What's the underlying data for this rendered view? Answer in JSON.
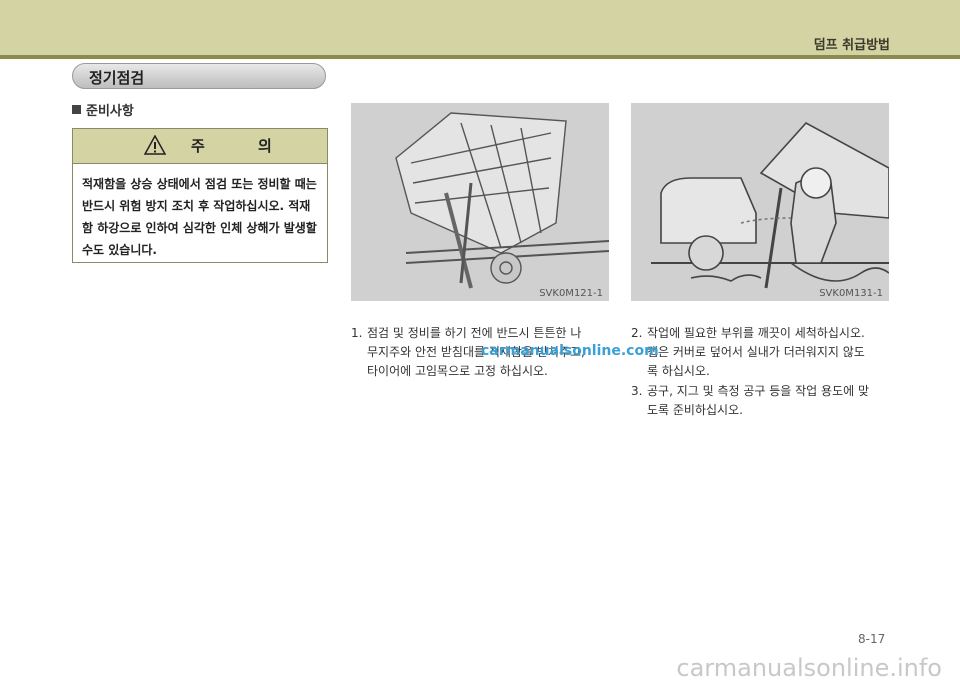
{
  "header": {
    "title": "덤프 취급방법"
  },
  "section": {
    "title": "정기점검"
  },
  "subsection": {
    "title": "준비사항"
  },
  "caution": {
    "title": "주 의",
    "lines": [
      "적재함을 상승 상태에서 점검 또는 정비할 때는",
      "반드시 위험 방지 조치 후 작업하십시오. 적재",
      "함 하강으로 인하여 심각한 인체 상해가 발생할",
      "수도 있습니다."
    ]
  },
  "figures": [
    {
      "code": "SVK0M121-1"
    },
    {
      "code": "SVK0M131-1"
    }
  ],
  "steps": [
    {
      "num": "1.",
      "lines": [
        "점검 및 정비를 하기 전에 반드시 튼튼한 나",
        "무지주와 안전 받침대를 적재함을 받쳐주고,",
        "타이어에 고임목으로 고정 하십시오."
      ]
    },
    {
      "num": "2.",
      "lines": [
        "작업에 필요한 부위를 깨끗이 세척하십시오.",
        "캡은 커버로 덮어서 실내가 더러워지지 않도",
        "록 하십시오."
      ]
    },
    {
      "num": "3.",
      "lines": [
        "공구, 지그 및 측정 공구 등을 작업 용도에 맞",
        "도록 준비하십시오."
      ]
    }
  ],
  "watermark": "carmanualsonline.com",
  "page_number": "8-17",
  "footer": "carmanualsonline.info"
}
